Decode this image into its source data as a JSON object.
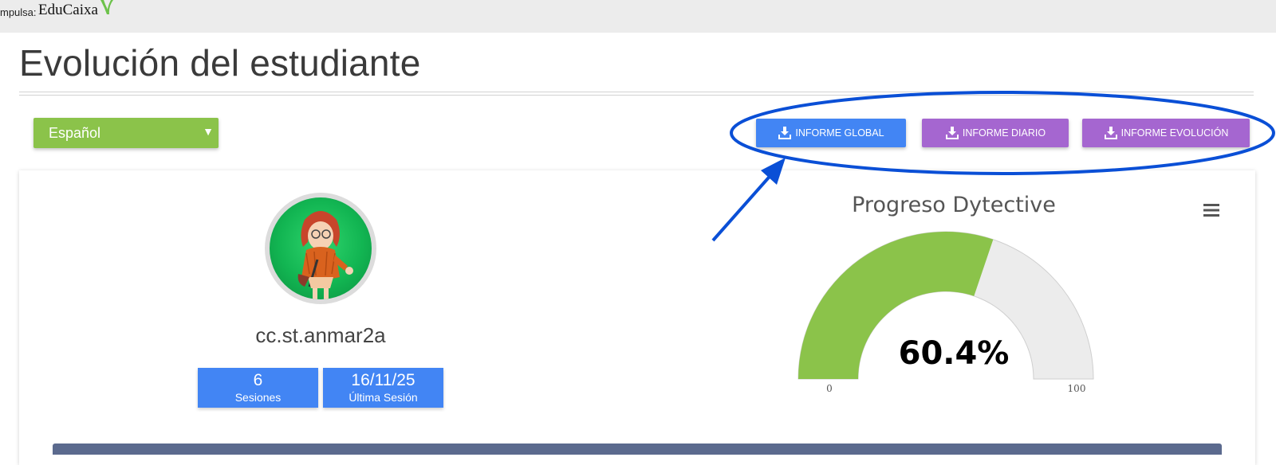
{
  "header": {
    "brand_prefix": "mpulsa:",
    "brand_name": "EduCaixa"
  },
  "page": {
    "title": "Evolución del estudiante"
  },
  "language_select": {
    "selected": "Español"
  },
  "actions": {
    "global_label": "INFORME GLOBAL",
    "daily_label": "INFORME DIARIO",
    "evolution_label": "INFORME EVOLUCIÓN"
  },
  "student": {
    "username": "cc.st.anmar2a",
    "sessions_value": "6",
    "sessions_label": "Sesiones",
    "last_session_value": "16/11/25",
    "last_session_label": "Última Sesión"
  },
  "chart_data": {
    "type": "gauge",
    "title": "Progreso Dytective",
    "value": 60.4,
    "value_label": "60.4%",
    "min": 0,
    "max": 100,
    "min_label": "0",
    "max_label": "100"
  },
  "colors": {
    "accent_green": "#8bc34a",
    "accent_blue": "#4285f4",
    "accent_purple": "#a566d0",
    "annotation_blue": "#0a4fd6"
  },
  "icons": [
    "download-icon",
    "hamburger-menu-icon",
    "dropdown-arrow-icon"
  ]
}
